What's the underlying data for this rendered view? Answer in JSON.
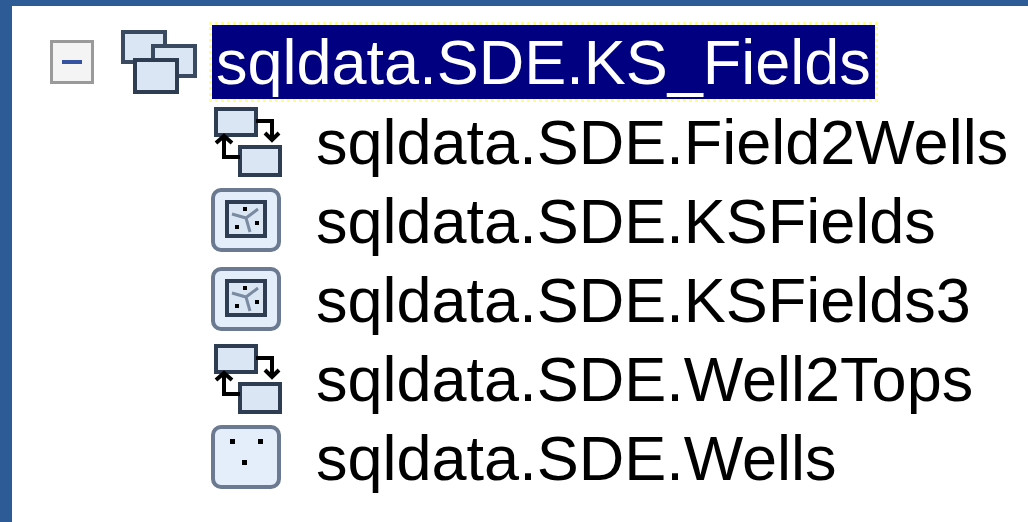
{
  "tree": {
    "items": [
      {
        "label": "sqldata.SDE.KS_Fields",
        "kind": "dataset",
        "expanded": true,
        "selected": true,
        "children": [
          {
            "label": "sqldata.SDE.Field2Wells",
            "kind": "relationship",
            "selected": false
          },
          {
            "label": "sqldata.SDE.KSFields",
            "kind": "polygon",
            "selected": false
          },
          {
            "label": "sqldata.SDE.KSFields3",
            "kind": "polygon",
            "selected": false
          },
          {
            "label": "sqldata.SDE.Well2Tops",
            "kind": "relationship",
            "selected": false
          },
          {
            "label": "sqldata.SDE.Wells",
            "kind": "point",
            "selected": false
          }
        ]
      }
    ]
  }
}
